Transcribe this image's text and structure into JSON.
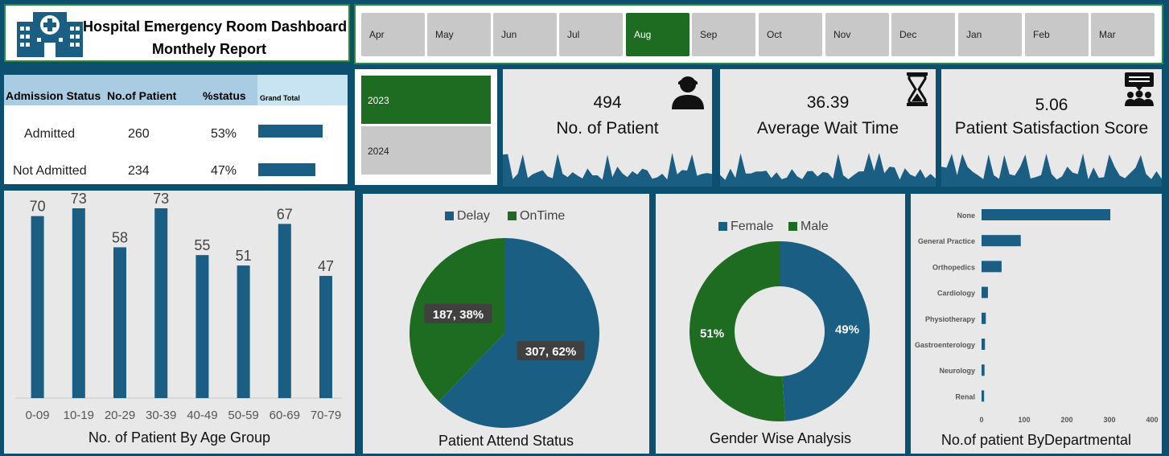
{
  "header": {
    "title_line1": "Hospital Emergency Room  Dashboard",
    "title_line2": "Monthely Report"
  },
  "months": {
    "items": [
      "Apr",
      "May",
      "Jun",
      "Jul",
      "Aug",
      "Sep",
      "Oct",
      "Nov",
      "Dec",
      "Jan",
      "Feb",
      "Mar"
    ],
    "selected": "Aug"
  },
  "years": {
    "items": [
      "2023",
      "2024"
    ],
    "selected": "2023"
  },
  "admission_table": {
    "headers": [
      "Admission Status",
      "No.of Patient",
      "%status",
      "Grand Total"
    ],
    "rows": [
      {
        "status": "Admitted",
        "count": "260",
        "pct": "53%",
        "bar": 0.53
      },
      {
        "status": "Not Admitted",
        "count": "234",
        "pct": "47%",
        "bar": 0.47
      }
    ]
  },
  "kpis": {
    "patients": {
      "value": "494",
      "label": "No. of Patient",
      "icon": "person-icon"
    },
    "wait": {
      "value": "36.39",
      "label": "Average Wait Time",
      "icon": "hourglass-icon"
    },
    "satisfaction": {
      "value": "5.06",
      "label": "Patient Satisfaction Score",
      "icon": "group-chat-icon"
    }
  },
  "colors": {
    "blue": "#1b5e84",
    "green": "#1e6b22",
    "panel": "#e8e8e8",
    "background": "#0d4f6e"
  },
  "chart_data": [
    {
      "type": "bar",
      "title": "No. of Patient By Age Group",
      "categories": [
        "0-09",
        "10-19",
        "20-29",
        "30-39",
        "40-49",
        "50-59",
        "60-69",
        "70-79"
      ],
      "values": [
        70,
        73,
        58,
        73,
        55,
        51,
        67,
        47
      ],
      "ylim": [
        0,
        73
      ]
    },
    {
      "type": "pie",
      "title": "Patient Attend Status",
      "labels": [
        "Delay",
        "OnTime"
      ],
      "values": [
        307,
        187
      ],
      "data_labels": [
        "307, 62%",
        "187, 38%"
      ],
      "legend": "top"
    },
    {
      "type": "pie",
      "title": "Gender Wise Analysis",
      "labels": [
        "Female",
        "Male"
      ],
      "values": [
        49,
        51
      ],
      "data_labels": [
        "49%",
        "51%"
      ],
      "legend": "top",
      "donut": true
    },
    {
      "type": "bar",
      "orientation": "horizontal",
      "title": "No.of patient ByDepartmental",
      "categories": [
        "None",
        "General Practice",
        "Orthopedics",
        "Cardiology",
        "Physiotherapy",
        "Gastroenterology",
        "Neurology",
        "Renal"
      ],
      "values": [
        302,
        92,
        47,
        15,
        10,
        8,
        7,
        6
      ],
      "xlim": [
        0,
        400
      ],
      "xticks": [
        "0",
        "100",
        "200",
        "300",
        "400"
      ]
    }
  ]
}
